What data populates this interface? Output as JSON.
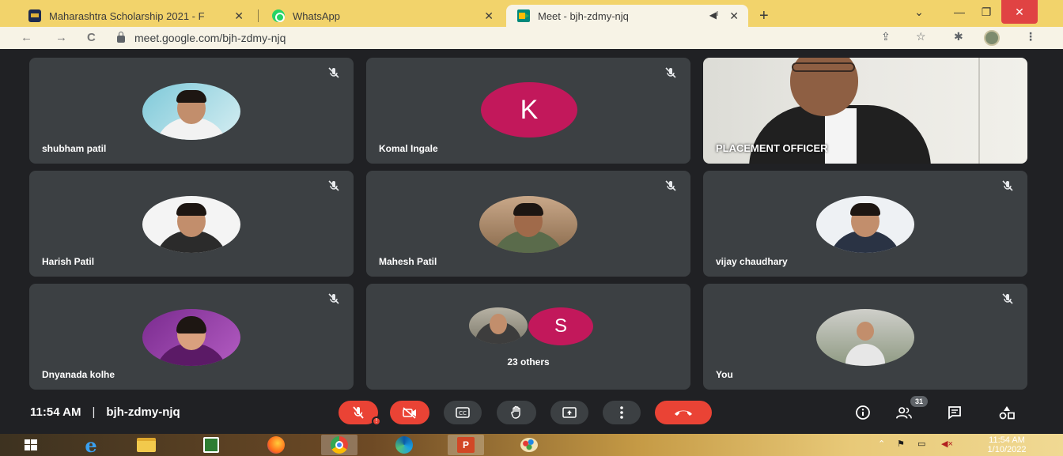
{
  "browser": {
    "tabs": [
      {
        "title": "Maharashtra Scholarship 2021 - F",
        "favicon": "scholarship-favicon",
        "active": false
      },
      {
        "title": "WhatsApp",
        "favicon": "whatsapp-favicon",
        "active": false
      },
      {
        "title": "Meet - bjh-zdmy-njq",
        "favicon": "google-meet-favicon",
        "active": true
      }
    ],
    "url": "meet.google.com/bjh-zdmy-njq",
    "colors": {
      "tab_strip": "#f2d36b",
      "toolbar": "#f7f3e6"
    }
  },
  "meeting": {
    "code": "bjh-zdmy-njq",
    "time": "11:54 AM",
    "separator": "|",
    "participant_count": "31",
    "tiles": [
      {
        "name": "shubham patil",
        "type": "photo",
        "muted": true
      },
      {
        "name": "Komal Ingale",
        "type": "initial",
        "initial": "K",
        "muted": true
      },
      {
        "name": "PLACEMENT OFFICER",
        "type": "video",
        "muted": false
      },
      {
        "name": "Harish Patil",
        "type": "photo",
        "muted": true
      },
      {
        "name": "Mahesh Patil",
        "type": "photo",
        "muted": true
      },
      {
        "name": "vijay chaudhary",
        "type": "photo",
        "muted": true
      },
      {
        "name": "Dnyanada kolhe",
        "type": "photo",
        "muted": true
      },
      {
        "name": "23 others",
        "type": "group",
        "initial": "S",
        "muted": false
      },
      {
        "name": "You",
        "type": "photo",
        "muted": true
      }
    ],
    "colors": {
      "background": "#202124",
      "tile": "#3c4043",
      "danger": "#ea4335",
      "avatar_magenta": "#c2185b"
    }
  },
  "controls": {
    "buttons": [
      "microphone-off",
      "camera-off",
      "captions",
      "raise-hand",
      "present-screen",
      "more-options",
      "leave-call"
    ],
    "right": [
      "meeting-details",
      "people",
      "chat",
      "activities"
    ]
  },
  "taskbar": {
    "apps": [
      "windows-start",
      "internet-explorer",
      "file-explorer",
      "microsoft-store",
      "firefox",
      "chrome",
      "edge",
      "powerpoint",
      "paint"
    ],
    "clock_time": "11:54 AM",
    "clock_date": "1/10/2022"
  }
}
